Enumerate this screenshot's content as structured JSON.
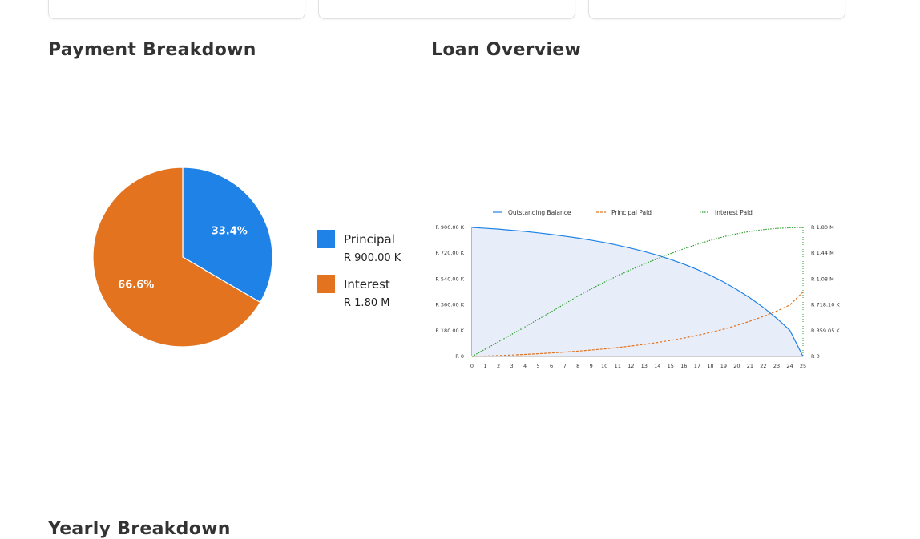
{
  "sections": {
    "payment_breakdown_title": "Payment Breakdown",
    "loan_overview_title": "Loan Overview",
    "yearly_breakdown_title": "Yearly Breakdown"
  },
  "colors": {
    "principal": "#1e82e6",
    "interest": "#e3731f",
    "balance_line": "#1e82e6",
    "balance_fill": "#e8eef9",
    "principal_paid_line": "#e3731f",
    "interest_paid_line": "#2ca02c"
  },
  "legend": [
    {
      "label": "Principal",
      "value": "R 900.00 K",
      "color": "#1e82e6"
    },
    {
      "label": "Interest",
      "value": "R 1.80 M",
      "color": "#e3731f"
    }
  ],
  "chart_data": [
    {
      "type": "pie",
      "labels": [
        "Principal",
        "Interest"
      ],
      "values": [
        33.4,
        66.6
      ],
      "slice_labels": [
        "33.4%",
        "66.6%"
      ]
    },
    {
      "type": "line",
      "x": [
        0,
        1,
        2,
        3,
        4,
        5,
        6,
        7,
        8,
        9,
        10,
        11,
        12,
        13,
        14,
        15,
        16,
        17,
        18,
        19,
        20,
        21,
        22,
        23,
        24,
        25
      ],
      "x_tick_labels": [
        "0",
        "1",
        "2",
        "3",
        "4",
        "5",
        "6",
        "7",
        "8",
        "9",
        "10",
        "11",
        "12",
        "13",
        "14",
        "15",
        "16",
        "17",
        "18",
        "19",
        "20",
        "21",
        "22",
        "23",
        "24",
        "25"
      ],
      "series": [
        {
          "name": "Outstanding Balance",
          "axis": "left",
          "style": "solid",
          "fill": true,
          "values": [
            900000,
            894000,
            888000,
            880000,
            872000,
            862000,
            851000,
            839000,
            826000,
            811000,
            795000,
            776000,
            755000,
            732000,
            706000,
            677000,
            644000,
            607000,
            566000,
            520000,
            467000,
            408000,
            342000,
            267000,
            183000,
            0
          ]
        },
        {
          "name": "Principal Paid",
          "axis": "right",
          "style": "dashed",
          "values": [
            0,
            6000,
            12000,
            20000,
            28000,
            38000,
            49000,
            61000,
            74000,
            89000,
            105000,
            124000,
            145000,
            168000,
            194000,
            223000,
            256000,
            293000,
            334000,
            380000,
            433000,
            492000,
            558000,
            633000,
            717000,
            900000
          ]
        },
        {
          "name": "Interest Paid",
          "axis": "right",
          "style": "dotted",
          "values": [
            0,
            102000,
            204000,
            308000,
            412000,
            518000,
            625000,
            733000,
            842000,
            943000,
            1037000,
            1126000,
            1210000,
            1289000,
            1364000,
            1435000,
            1502000,
            1564000,
            1620000,
            1671000,
            1711000,
            1745000,
            1769000,
            1786000,
            1795000,
            1800000
          ]
        }
      ],
      "left_ylim": [
        0,
        900000
      ],
      "right_ylim": [
        0,
        1800000
      ],
      "left_tick_labels": [
        "R 900.00 K",
        "R 720.00 K",
        "R 540.00 K",
        "R 360.00 K",
        "R 180.00 K",
        "R 0"
      ],
      "right_tick_labels": [
        "R 1.80 M",
        "R 1.44 M",
        "R 1.08 M",
        "R 718.10 K",
        "R 359.05 K",
        "R 0"
      ],
      "legend_position": "top"
    }
  ]
}
